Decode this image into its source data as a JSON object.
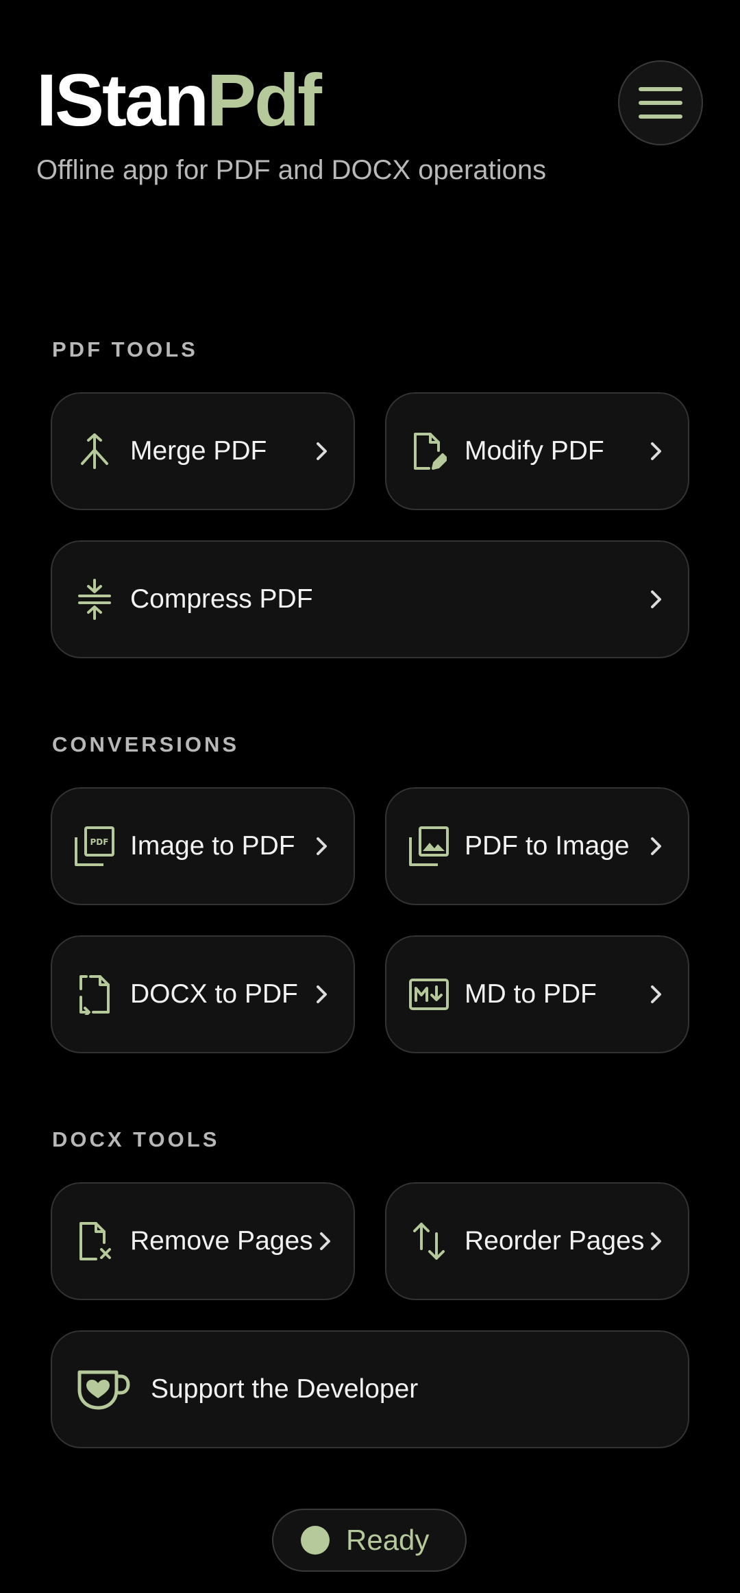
{
  "app": {
    "title_main": "IStan",
    "title_accent": "Pdf",
    "subtitle": "Offline app for PDF and DOCX operations"
  },
  "colors": {
    "accent": "#b5c99a",
    "background": "#000000",
    "card": "#121212",
    "border": "#333333"
  },
  "menu": {
    "icon": "hamburger-menu-icon"
  },
  "sections": {
    "pdf_tools": {
      "label": "PDF TOOLS",
      "items": [
        {
          "label": "Merge PDF",
          "icon": "merge-icon"
        },
        {
          "label": "Modify PDF",
          "icon": "file-edit-icon"
        },
        {
          "label": "Compress PDF",
          "icon": "compress-icon"
        }
      ]
    },
    "conversions": {
      "label": "CONVERSIONS",
      "items": [
        {
          "label": "Image to PDF",
          "icon": "pdf-file-icon"
        },
        {
          "label": "PDF to Image",
          "icon": "image-library-icon"
        },
        {
          "label": "DOCX to PDF",
          "icon": "file-convert-icon"
        },
        {
          "label": "MD to PDF",
          "icon": "markdown-icon"
        }
      ]
    },
    "docx_tools": {
      "label": "DOCX TOOLS",
      "items": [
        {
          "label": "Remove Pages",
          "icon": "file-remove-icon"
        },
        {
          "label": "Reorder Pages",
          "icon": "swap-vertical-icon"
        }
      ]
    }
  },
  "support": {
    "label": "Support the Developer",
    "icon": "coffee-heart-icon"
  },
  "status": {
    "label": "Ready"
  }
}
